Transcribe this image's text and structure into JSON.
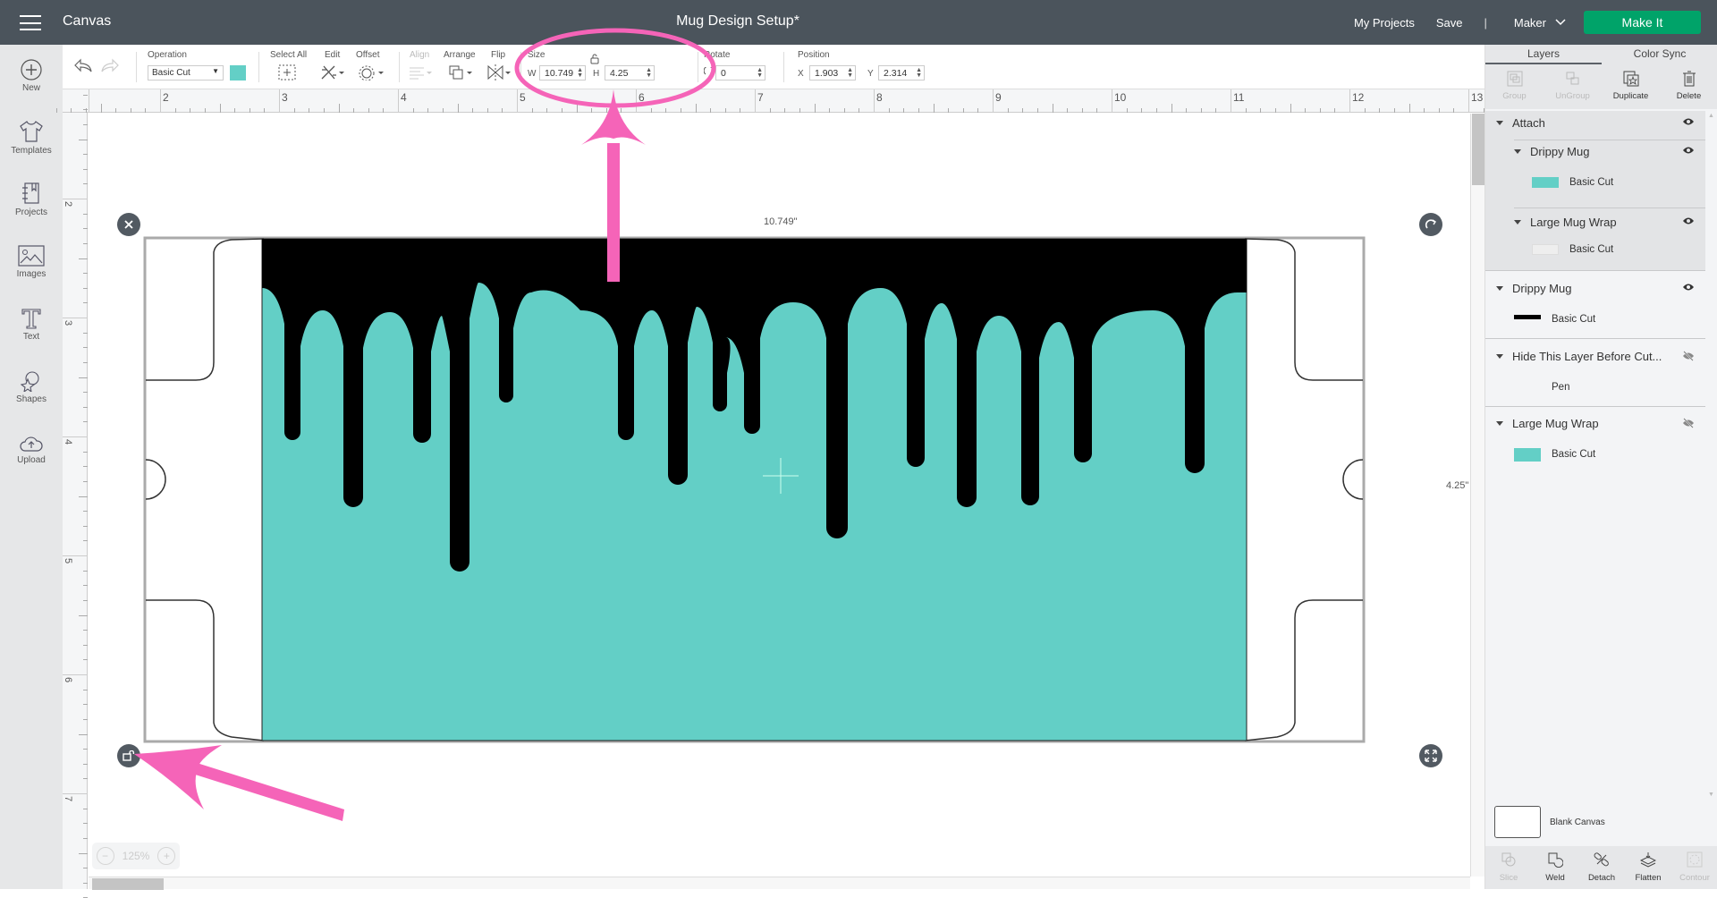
{
  "topbar": {
    "menu_icon": "hamburger-menu-icon",
    "app_title": "Canvas",
    "document_title": "Mug Design Setup*",
    "my_projects": "My Projects",
    "save": "Save",
    "separator": "|",
    "machine": "Maker",
    "make_it": "Make It"
  },
  "leftnav": {
    "items": [
      {
        "label": "New",
        "icon": "plus-circle-icon"
      },
      {
        "label": "Templates",
        "icon": "tshirt-icon"
      },
      {
        "label": "Projects",
        "icon": "notebook-icon"
      },
      {
        "label": "Images",
        "icon": "image-icon"
      },
      {
        "label": "Text",
        "icon": "text-t-icon"
      },
      {
        "label": "Shapes",
        "icon": "shapes-icon"
      },
      {
        "label": "Upload",
        "icon": "cloud-upload-icon"
      }
    ]
  },
  "toolbar": {
    "operation_label": "Operation",
    "operation_value": "Basic Cut",
    "operation_color": "#63cfc6",
    "select_all": "Select All",
    "edit": "Edit",
    "offset": "Offset",
    "align": "Align",
    "arrange": "Arrange",
    "flip": "Flip",
    "size_label": "Size",
    "w_label": "W",
    "w_value": "10.749",
    "h_label": "H",
    "h_value": "4.25",
    "rotate_label": "Rotate",
    "rotate_value": "0",
    "position_label": "Position",
    "x_label": "X",
    "x_value": "1.903",
    "y_label": "Y",
    "y_value": "2.314"
  },
  "rulers": {
    "horizontal": [
      "2",
      "3",
      "4",
      "5",
      "6",
      "7",
      "8",
      "9",
      "10",
      "11",
      "12",
      "13"
    ],
    "vertical": [
      "2",
      "3",
      "4",
      "5",
      "6",
      "7"
    ]
  },
  "canvas": {
    "width_label": "10.749\"",
    "height_label": "4.25\"",
    "zoom": "125%",
    "drip_color": "#000000",
    "fill_color": "#63cfc6",
    "annotation_color": "#f564b8"
  },
  "panel": {
    "tabs": [
      "Layers",
      "Color Sync"
    ],
    "actions": [
      "Group",
      "UnGroup",
      "Duplicate",
      "Delete"
    ],
    "layers": [
      {
        "name": "Attach",
        "visible": true,
        "children": [
          {
            "name": "Drippy Mug",
            "visible": true,
            "operation": "Basic Cut"
          },
          {
            "name": "Large Mug Wrap",
            "visible": true,
            "operation": "Basic Cut"
          }
        ]
      },
      {
        "name": "Drippy Mug",
        "visible": true,
        "operation": "Basic Cut"
      },
      {
        "name": "Hide This Layer Before Cut...",
        "visible": false,
        "operation": "Pen"
      },
      {
        "name": "Large Mug Wrap",
        "visible": false,
        "operation": "Basic Cut"
      }
    ],
    "blank_canvas": "Blank Canvas",
    "bottom_actions": [
      "Slice",
      "Weld",
      "Detach",
      "Flatten",
      "Contour"
    ]
  }
}
